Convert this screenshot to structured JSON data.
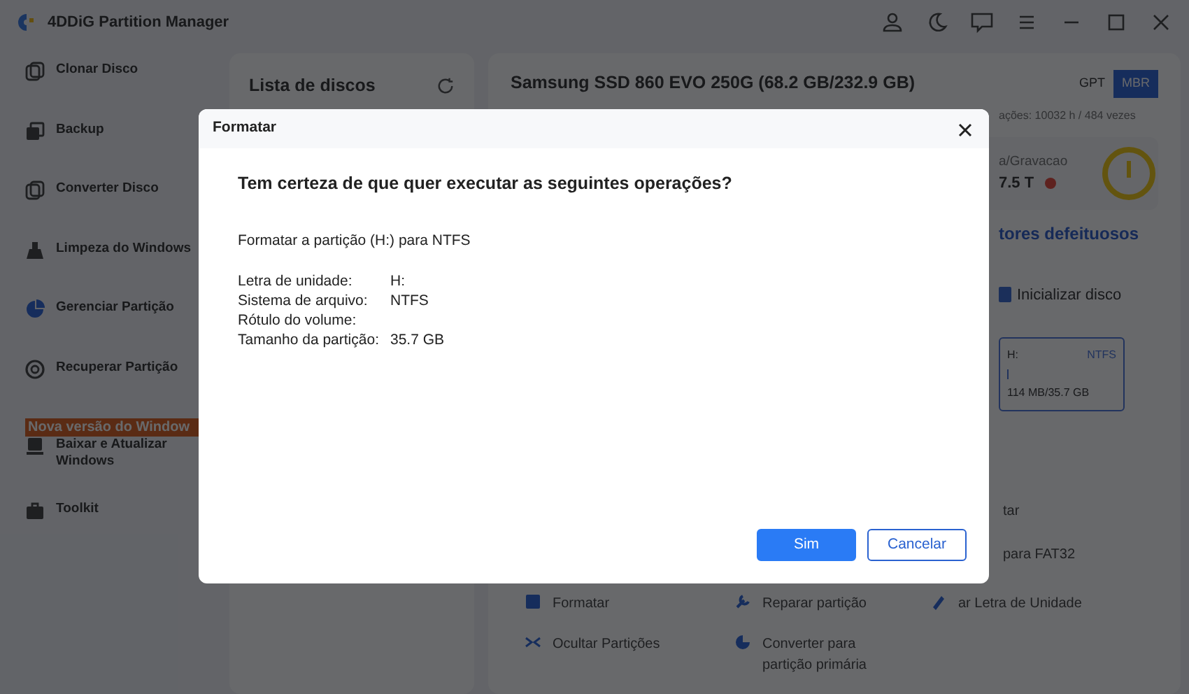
{
  "window": {
    "title": "4DDiG Partition Manager"
  },
  "sidebar": {
    "items": [
      {
        "label": "Clonar Disco",
        "selected": false
      },
      {
        "label": "Backup",
        "selected": false
      },
      {
        "label": "Converter Disco",
        "selected": false
      },
      {
        "label": "Limpeza do Windows",
        "selected": false
      },
      {
        "label": "Gerenciar Partição",
        "selected": true
      },
      {
        "label": "Recuperar Partição",
        "selected": false
      },
      {
        "label": "Baixar e Atualizar Windows",
        "selected": false
      },
      {
        "label": "Toolkit",
        "selected": false
      }
    ],
    "banner": "Nova versão do Window"
  },
  "disk_list": {
    "title": "Lista de discos"
  },
  "disk": {
    "title": "Samsung SSD 860 EVO 250G (68.2 GB/232.9 GB)",
    "partition_styles": [
      {
        "label": "GPT",
        "selected": false
      },
      {
        "label": "MBR",
        "selected": true
      }
    ],
    "info": "ações: 10032 h / 484 vezes",
    "stat_label": "a/Gravacao",
    "stat_value": "7.5 T",
    "bad_sectors_link": "tores defeituosos",
    "initialize": "Inicializar disco",
    "partition": {
      "letter": "H:",
      "filesystem": "NTFS",
      "usage": "114 MB/35.7 GB",
      "level": 0.02
    }
  },
  "operations_right": [
    {
      "label": "tar"
    },
    {
      "label": "para FAT32"
    }
  ],
  "operations": [
    {
      "label": "Formatar"
    },
    {
      "label": "Reparar partição"
    },
    {
      "label": "ar Letra de Unidade"
    },
    {
      "label": "Ocultar Partições"
    },
    {
      "label": "Converter para partição primária"
    }
  ],
  "dialog": {
    "title": "Formatar",
    "question": "Tem certeza de que quer executar as seguintes operações?",
    "summary": "Formatar a partição (H:) para NTFS",
    "details": [
      {
        "label": "Letra de unidade:",
        "value": "H:"
      },
      {
        "label": "Sistema de arquivo:",
        "value": "NTFS"
      },
      {
        "label": "Rótulo do volume:"
      },
      {
        "label": "Tamanho da partição:",
        "value": "35.7 GB"
      }
    ],
    "buttons": [
      {
        "label": "Sim",
        "kind": "primary"
      },
      {
        "label": "Cancelar",
        "kind": "secondary"
      }
    ]
  }
}
